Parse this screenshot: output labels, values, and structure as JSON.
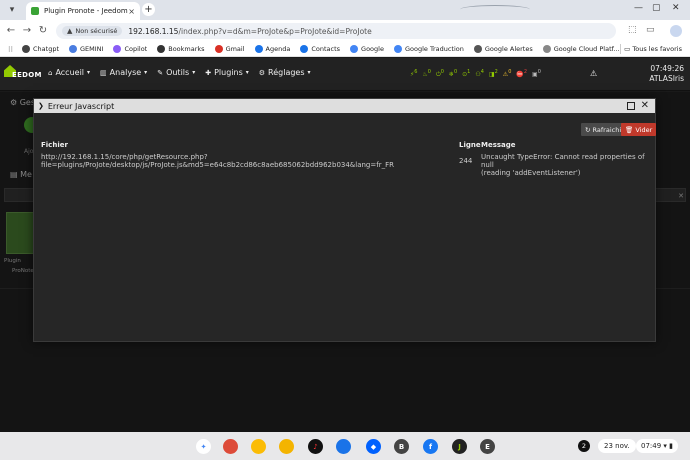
{
  "browser": {
    "tab_title": "Plugin Pronote - Jeedom Atlas",
    "tab_close": "×",
    "new_tab": "+",
    "security_label": "Non sécurisé",
    "url_host": "192.168.1.15",
    "url_path": "/index.php?v=d&m=ProJote&p=ProJote&id=ProJote",
    "bookmarks": [
      {
        "label": "Chatgpt",
        "color": "#444"
      },
      {
        "label": "GEMINI",
        "color": "#4a7de0"
      },
      {
        "label": "Copilot",
        "color": "#8a5cf6"
      },
      {
        "label": "Bookmarks",
        "color": "#333"
      },
      {
        "label": "Gmail",
        "color": "#d93025"
      },
      {
        "label": "Agenda",
        "color": "#1a73e8"
      },
      {
        "label": "Contacts",
        "color": "#1a73e8"
      },
      {
        "label": "Google",
        "color": "#4285f4"
      },
      {
        "label": "Google Traduction",
        "color": "#4285f4"
      },
      {
        "label": "Google Alertes",
        "color": "#555"
      },
      {
        "label": "Google Cloud Platf...",
        "color": "#888"
      }
    ],
    "all_bookmarks": "Tous les favoris"
  },
  "jeedom": {
    "logo_text": "EEDOM",
    "menu": [
      {
        "label": "Accueil",
        "icon": "home-icon"
      },
      {
        "label": "Analyse",
        "icon": "chart-icon"
      },
      {
        "label": "Outils",
        "icon": "wrench-icon"
      },
      {
        "label": "Plugins",
        "icon": "puzzle-icon"
      },
      {
        "label": "Réglages",
        "icon": "gear-icon"
      }
    ],
    "status": [
      {
        "text": "6",
        "cls": ""
      },
      {
        "text": "0",
        "cls": ""
      },
      {
        "text": "0",
        "cls": ""
      },
      {
        "text": "0",
        "cls": ""
      },
      {
        "text": "1",
        "cls": ""
      },
      {
        "text": "4",
        "cls": ""
      },
      {
        "text": "2",
        "cls": ""
      },
      {
        "text": "0",
        "cls": "yel"
      },
      {
        "text": "2",
        "cls": "red"
      },
      {
        "text": "0",
        "cls": "gray"
      }
    ],
    "time": "07:49:26",
    "hostname": "ATLASIris"
  },
  "background": {
    "title": "Ges",
    "add_label": "Ajo",
    "section": "Me",
    "card_label": "Plugin",
    "card_name": "ProNote"
  },
  "modal": {
    "title": "Erreur Javascript",
    "refresh_label": "Rafraichir",
    "clear_label": "Vider",
    "col_file": "Fichier",
    "col_line": "Ligne",
    "col_message": "Message",
    "row": {
      "file_line1": "http://192.168.1.15/core/php/getResource.php?",
      "file_line2": "file=plugins/ProJote/desktop/js/ProJote.js&md5=e64c8b2cd86c8aeb685062bdd962b034&lang=fr_FR",
      "line": "244",
      "message_line1": "Uncaught TypeError: Cannot read properties of null",
      "message_line2": "(reading 'addEventListener')"
    }
  },
  "shelf": {
    "apps": [
      {
        "name": "launcher",
        "color": "#fff",
        "text": "✦",
        "fg": "#4285f4"
      },
      {
        "name": "chrome",
        "color": "#dd4b39",
        "text": "",
        "fg": "#fff"
      },
      {
        "name": "photos",
        "color": "#fbbc05",
        "text": "",
        "fg": "#fff"
      },
      {
        "name": "keep",
        "color": "#f4b400",
        "text": "",
        "fg": "#fff"
      },
      {
        "name": "youtube-music",
        "color": "#111",
        "text": "♪",
        "fg": "#f33"
      },
      {
        "name": "messages",
        "color": "#1a73e8",
        "text": "",
        "fg": "#fff"
      },
      {
        "name": "dropbox",
        "color": "#0061fe",
        "text": "◆",
        "fg": "#fff"
      },
      {
        "name": "app-b",
        "color": "#444",
        "text": "B",
        "fg": "#fff"
      },
      {
        "name": "facebook",
        "color": "#1877f2",
        "text": "f",
        "fg": "#fff"
      },
      {
        "name": "jeedom",
        "color": "#222",
        "text": "J",
        "fg": "#93ca02"
      },
      {
        "name": "app-e",
        "color": "#444",
        "text": "E",
        "fg": "#fff"
      }
    ],
    "badge": "2",
    "date": "23 nov.",
    "time": "07:49"
  }
}
